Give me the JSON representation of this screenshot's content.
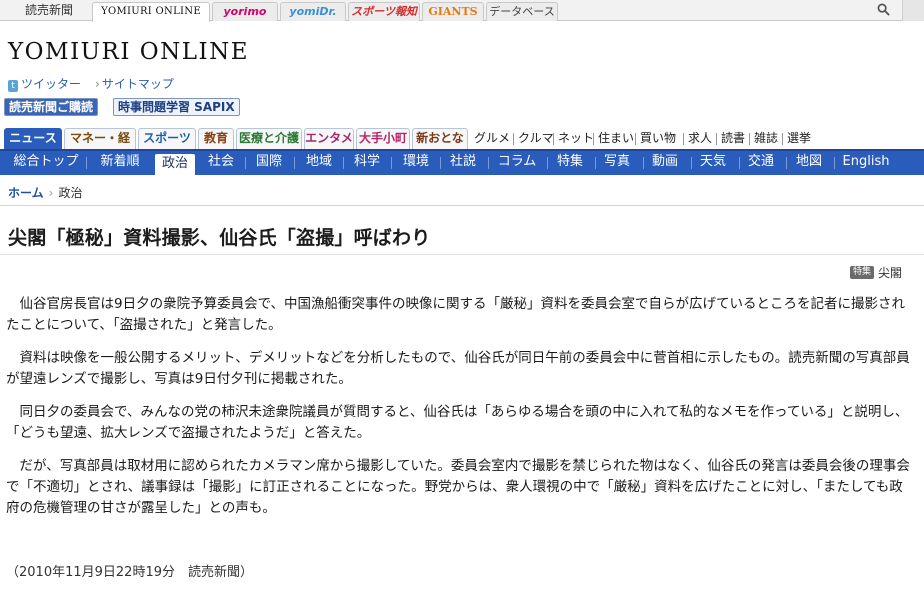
{
  "portal": {
    "tabs": [
      "読売新聞",
      "YOMIURI ONLINE",
      "yorimo",
      "yomiDr.",
      "スポーツ報知",
      "GIANTS",
      "データベース"
    ]
  },
  "site": {
    "logo": "YOMIURI ONLINE",
    "twitter": "ツイッター",
    "sitemap": "サイトマップ",
    "promo1": "読売新聞ご購読",
    "promo2": "時事問題学習 SAPIX"
  },
  "genres": {
    "tabs": [
      "ニュース",
      "マネー・経済",
      "スポーツ",
      "教育",
      "医療と介護",
      "エンタメ",
      "大手小町",
      "新おとな"
    ],
    "links": [
      "グルメ",
      "クルマ",
      "ネット",
      "住まい",
      "買い物",
      "求人",
      "読書",
      "雑誌",
      "選挙"
    ]
  },
  "categories": [
    "総合トップ",
    "新着順",
    "政治",
    "社会",
    "国際",
    "地域",
    "科学",
    "環境",
    "社説",
    "コラム",
    "特集",
    "写真",
    "動画",
    "天気",
    "交通",
    "地図",
    "English"
  ],
  "breadcrumb": {
    "home": "ホーム",
    "current": "政治"
  },
  "article": {
    "headline": "尖閣「極秘」資料撮影、仙谷氏「盗撮」呼ばわり",
    "tag_badge": "特集",
    "tag_label": "尖閣",
    "paragraphs": [
      "仙谷官房長官は9日夕の衆院予算委員会で、中国漁船衝突事件の映像に関する「厳秘」資料を委員会室で自らが広げているところを記者に撮影されたことについて、「盗撮された」と発言した。",
      "資料は映像を一般公開するメリット、デメリットなどを分析したもので、仙谷氏が同日午前の委員会中に菅首相に示したもの。読売新聞の写真部員が望遠レンズで撮影し、写真は9日付夕刊に掲載された。",
      "同日夕の委員会で、みんなの党の柿沢未途衆院議員が質問すると、仙谷氏は「あらゆる場合を頭の中に入れて私的なメモを作っている」と説明し、「どうも望遠、拡大レンズで盗撮されたようだ」と答えた。",
      "だが、写真部員は取材用に認められたカメラマン席から撮影していた。委員会室内で撮影を禁じられた物はなく、仙谷氏の発言は委員会後の理事会で「不適切」とされ、議事録は「撮影」に訂正されることになった。野党からは、衆人環視の中で「厳秘」資料を広げたことに対し、「またしても政府の危機管理の甘さが露呈した」との声も。"
    ],
    "dateline": "（2010年11月9日22時19分　読売新聞）"
  }
}
